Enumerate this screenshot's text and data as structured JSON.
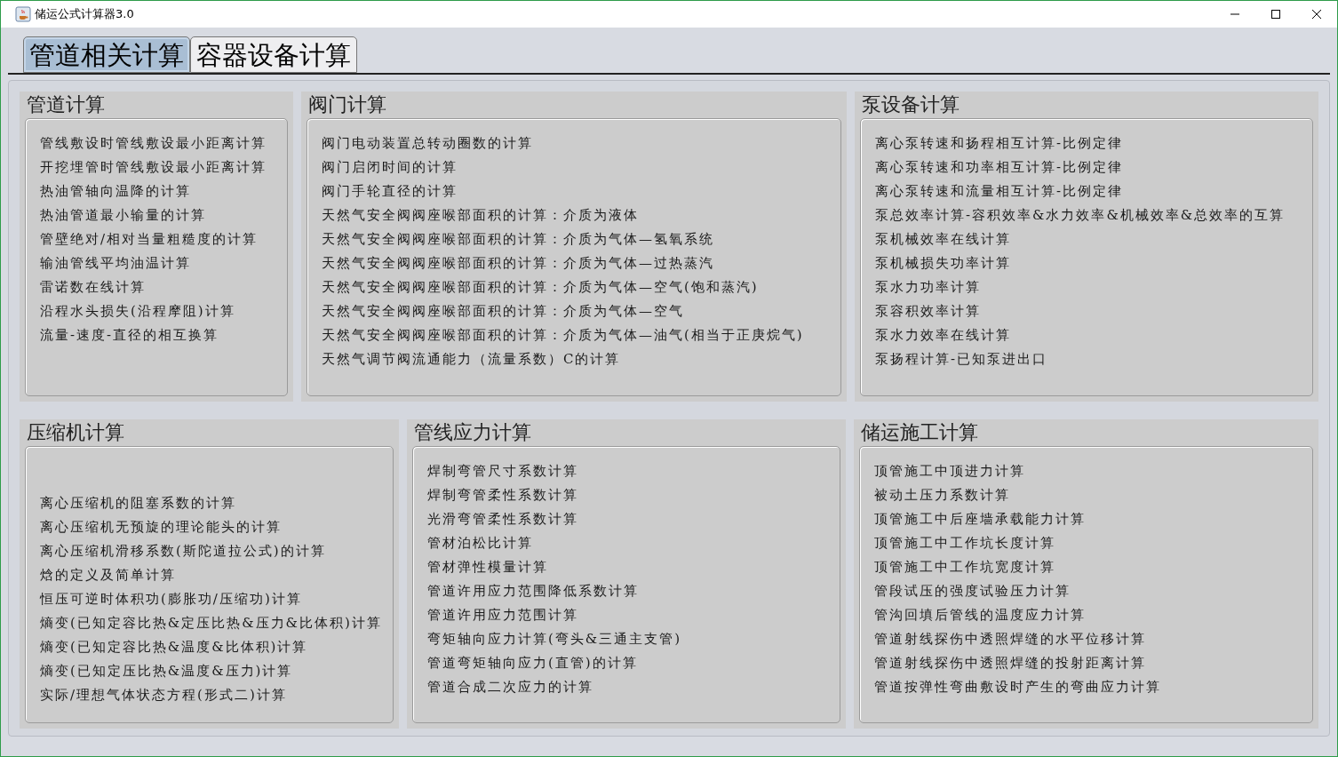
{
  "window": {
    "title": "储运公式计算器3.0"
  },
  "tabs": [
    {
      "label": "管道相关计算",
      "selected": true
    },
    {
      "label": "容器设备计算",
      "selected": false
    }
  ],
  "panel_rows": [
    [
      {
        "title": "管道计算",
        "items": [
          "管线敷设时管线敷设最小距离计算",
          "开挖埋管时管线敷设最小距离计算",
          "热油管轴向温降的计算",
          "热油管道最小输量的计算",
          "管壁绝对/相对当量粗糙度的计算",
          "输油管线平均油温计算",
          "雷诺数在线计算",
          "沿程水头损失(沿程摩阻)计算",
          "流量-速度-直径的相互换算"
        ]
      },
      {
        "title": "阀门计算",
        "items": [
          "阀门电动装置总转动圈数的计算",
          "阀门启闭时间的计算",
          "阀门手轮直径的计算",
          "天然气安全阀阀座喉部面积的计算：介质为液体",
          "天然气安全阀阀座喉部面积的计算：介质为气体—氢氧系统",
          "天然气安全阀阀座喉部面积的计算：介质为气体—过热蒸汽",
          "天然气安全阀阀座喉部面积的计算：介质为气体—空气(饱和蒸汽)",
          "天然气安全阀阀座喉部面积的计算：介质为气体—空气",
          "天然气安全阀阀座喉部面积的计算：介质为气体—油气(相当于正庚烷气)",
          "天然气调节阀流通能力（流量系数）C的计算"
        ]
      },
      {
        "title": "泵设备计算",
        "items": [
          "离心泵转速和扬程相互计算-比例定律",
          "离心泵转速和功率相互计算-比例定律",
          "离心泵转速和流量相互计算-比例定律",
          "泵总效率计算-容积效率&水力效率&机械效率&总效率的互算",
          "泵机械效率在线计算",
          "泵机械损失功率计算",
          "泵水力功率计算",
          "泵容积效率计算",
          "泵水力效率在线计算",
          "泵扬程计算-已知泵进出口"
        ]
      }
    ],
    [
      {
        "title": "压缩机计算",
        "items": [
          "离心压缩机的阻塞系数的计算",
          "离心压缩机无预旋的理论能头的计算",
          "离心压缩机滑移系数(斯陀道拉公式)的计算",
          "焓的定义及简单计算",
          "恒压可逆时体积功(膨胀功/压缩功)计算",
          "熵变(已知定容比热&定压比热&压力&比体积)计算",
          "熵变(已知定容比热&温度&比体积)计算",
          "熵变(已知定压比热&温度&压力)计算",
          "实际/理想气体状态方程(形式二)计算"
        ]
      },
      {
        "title": "管线应力计算",
        "items": [
          "焊制弯管尺寸系数计算",
          "焊制弯管柔性系数计算",
          "光滑弯管柔性系数计算",
          "管材泊松比计算",
          "管材弹性模量计算",
          "管道许用应力范围降低系数计算",
          "管道许用应力范围计算",
          "弯矩轴向应力计算(弯头&三通主支管)",
          "管道弯矩轴向应力(直管)的计算",
          "管道合成二次应力的计算"
        ]
      },
      {
        "title": "储运施工计算",
        "items": [
          "顶管施工中顶进力计算",
          "被动土压力系数计算",
          "顶管施工中后座墙承载能力计算",
          "顶管施工中工作坑长度计算",
          "顶管施工中工作坑宽度计算",
          "管段试压的强度试验压力计算",
          "管沟回填后管线的温度应力计算",
          "管道射线探伤中透照焊缝的水平位移计算",
          "管道射线探伤中透照焊缝的投射距离计算",
          "管道按弹性弯曲敷设时产生的弯曲应力计算"
        ]
      }
    ]
  ]
}
